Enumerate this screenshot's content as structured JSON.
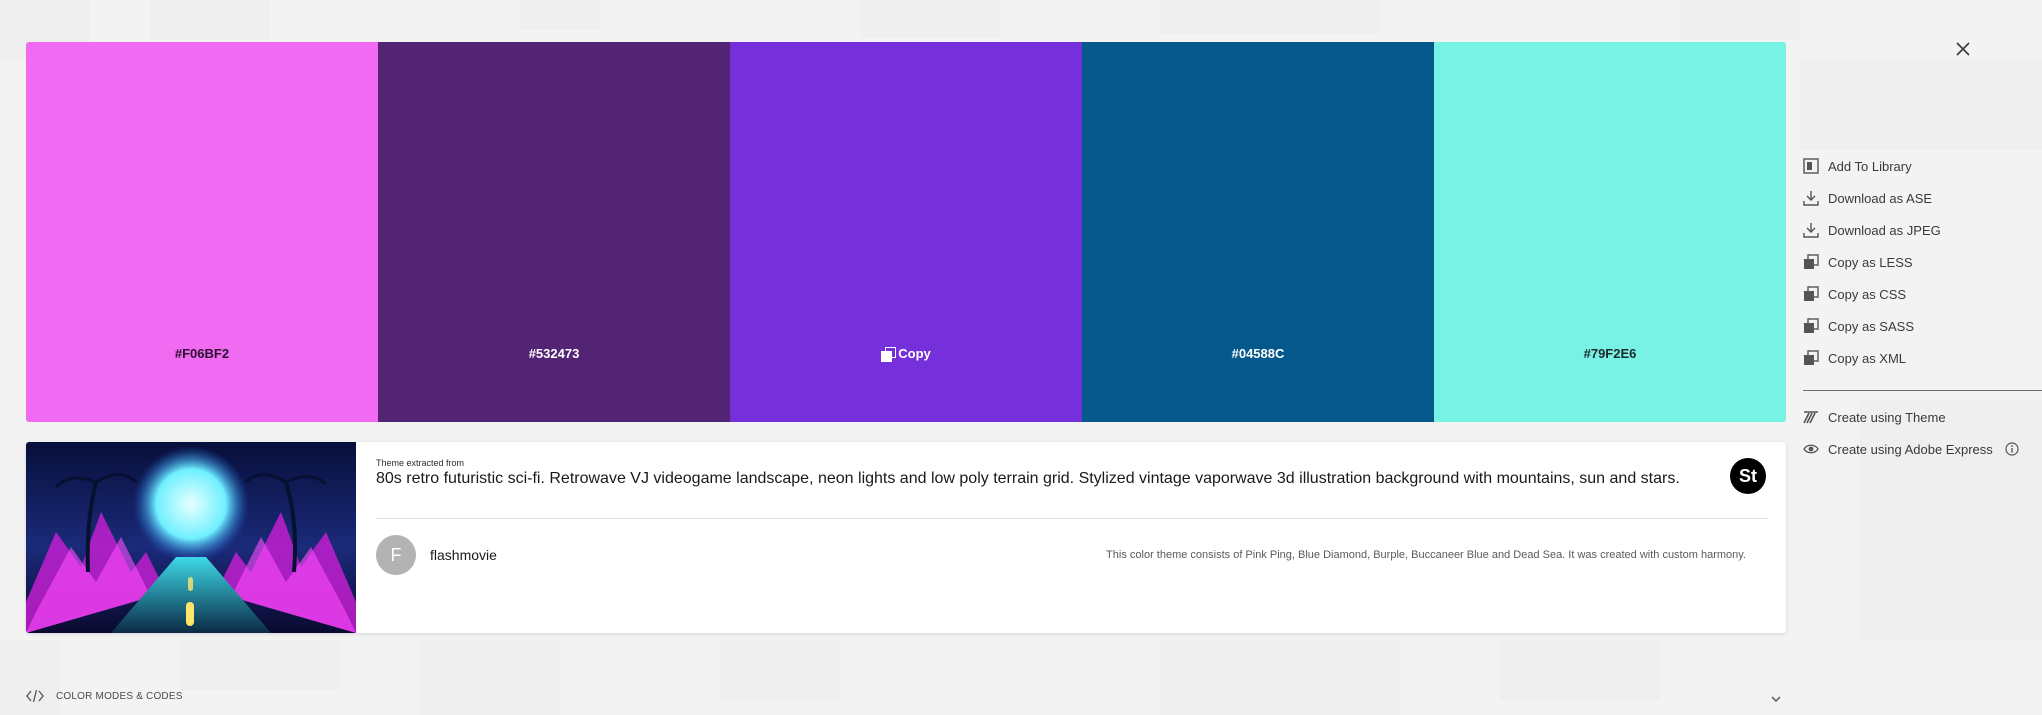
{
  "swatches": [
    {
      "hex": "#F06BF2",
      "label": "#F06BF2",
      "text_color": "#2a1030"
    },
    {
      "hex": "#532473",
      "label": "#532473",
      "text_color": "#ffffff"
    },
    {
      "hex": "#7530DB",
      "label": "Copy",
      "text_color": "#ffffff"
    },
    {
      "hex": "#04588C",
      "label": "#04588C",
      "text_color": "#ffffff"
    },
    {
      "hex": "#79F2E6",
      "label": "#79F2E6",
      "text_color": "#1a2a2a"
    }
  ],
  "actions": [
    {
      "label": "Add To Library",
      "icon": "library-icon"
    },
    {
      "label": "Download as ASE",
      "icon": "download-icon"
    },
    {
      "label": "Download as JPEG",
      "icon": "download-icon"
    },
    {
      "label": "Copy as LESS",
      "icon": "copy-icon"
    },
    {
      "label": "Copy as CSS",
      "icon": "copy-icon"
    },
    {
      "label": "Copy as SASS",
      "icon": "copy-icon"
    },
    {
      "label": "Copy as XML",
      "icon": "copy-icon"
    }
  ],
  "create_actions": [
    {
      "label": "Create using Theme",
      "icon": "theme-brush-icon"
    },
    {
      "label": "Create using Adobe Express",
      "icon": "eye-icon"
    }
  ],
  "card": {
    "extracted_label": "Theme extracted from",
    "title": "80s retro futuristic sci-fi. Retrowave VJ videogame landscape, neon lights and low poly terrain grid. Stylized vintage vaporwave 3d illustration background with mountains, sun and stars.",
    "stock_badge": "St",
    "avatar_initial": "F",
    "username": "flashmovie",
    "description": "This color theme consists of Pink Ping, Blue Diamond, Burple, Buccaneer Blue and Dead Sea. It was created with custom harmony."
  },
  "footer": {
    "modes_label": "COLOR MODES & CODES"
  }
}
